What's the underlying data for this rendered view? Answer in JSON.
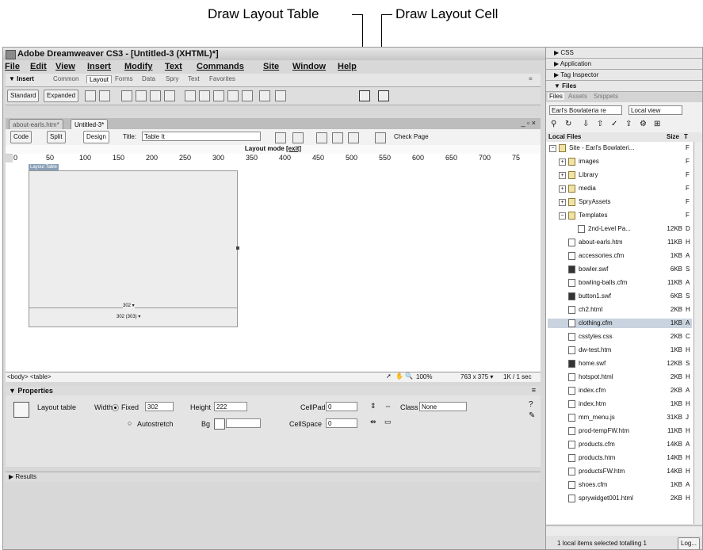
{
  "callouts": {
    "draw_layout_table": "Draw Layout Table",
    "draw_layout_cell": "Draw Layout Cell"
  },
  "window": {
    "title": "Adobe Dreamweaver CS3 - [Untitled-3 (XHTML)*]",
    "controls": [
      "_",
      "□",
      "×"
    ]
  },
  "menu": [
    "File",
    "Edit",
    "View",
    "Insert",
    "Modify",
    "Text",
    "Commands",
    "Site",
    "Window",
    "Help"
  ],
  "insert_bar": {
    "label": "▼ Insert",
    "tabs": [
      "Common",
      "Layout",
      "Forms",
      "Data",
      "Spry",
      "Text",
      "Favorites"
    ],
    "active_tab": "Layout",
    "buttons": [
      "Standard",
      "Expanded"
    ]
  },
  "documents": {
    "tabs": [
      "about-earls.htm*",
      "Untitled-3*"
    ],
    "active": "Untitled-3*",
    "view_buttons": [
      "Code",
      "Split",
      "Design"
    ],
    "title_label": "Title:",
    "title_value": "Table It",
    "check_page": "Check Page",
    "layout_mode": "Layout mode",
    "exit": "[exit]"
  },
  "ruler": {
    "ticks": [
      "0",
      "50",
      "100",
      "150",
      "200",
      "250",
      "300",
      "350",
      "400",
      "450",
      "500",
      "550",
      "600",
      "650",
      "700",
      "75"
    ]
  },
  "layout_table": {
    "label": "Layout Table",
    "width_label_1": "302 ▾",
    "width_label_2": "302 (303) ▾"
  },
  "status": {
    "tags": "<body> <table>",
    "zoom": "100%",
    "size": "763 x 375 ▾",
    "download": "1K / 1 sec"
  },
  "properties": {
    "header": "▼ Properties",
    "type": "Layout table",
    "width_label": "Width",
    "fixed_label": "Fixed",
    "width_value": "302",
    "autostretch_label": "Autostretch",
    "height_label": "Height",
    "height_value": "222",
    "bg_label": "Bg",
    "cellpad_label": "CellPad",
    "cellpad_value": "0",
    "cellspace_label": "CellSpace",
    "cellspace_value": "0",
    "class_label": "Class",
    "class_value": "None"
  },
  "results": {
    "label": "▶ Results"
  },
  "panels": {
    "groups": [
      "▶ CSS",
      "▶ Application",
      "▶ Tag Inspector",
      "▼ Files"
    ],
    "files_tabs": [
      "Files",
      "Assets",
      "Snippets"
    ],
    "site_select": "Earl's Bowlateria re",
    "view_select": "Local view",
    "col_local": "Local Files",
    "col_size": "Size",
    "col_type": "T",
    "tree": [
      {
        "name": "Site - Earl's Bowlateri...",
        "size": "",
        "type": "F",
        "level": 0,
        "kind": "site",
        "exp": "−"
      },
      {
        "name": "images",
        "size": "",
        "type": "F",
        "level": 1,
        "kind": "folder",
        "exp": "+"
      },
      {
        "name": "Library",
        "size": "",
        "type": "F",
        "level": 1,
        "kind": "folder",
        "exp": "+"
      },
      {
        "name": "media",
        "size": "",
        "type": "F",
        "level": 1,
        "kind": "folder",
        "exp": "+"
      },
      {
        "name": "SpryAssets",
        "size": "",
        "type": "F",
        "level": 1,
        "kind": "folder",
        "exp": "+"
      },
      {
        "name": "Templates",
        "size": "",
        "type": "F",
        "level": 1,
        "kind": "folder",
        "exp": "−"
      },
      {
        "name": "2nd-Level Pa...",
        "size": "12KB",
        "type": "D",
        "level": 2,
        "kind": "file",
        "exp": ""
      },
      {
        "name": "about-earls.htm",
        "size": "11KB",
        "type": "H",
        "level": 1,
        "kind": "file",
        "exp": ""
      },
      {
        "name": "accessories.cfm",
        "size": "1KB",
        "type": "A",
        "level": 1,
        "kind": "file",
        "exp": ""
      },
      {
        "name": "bowler.swf",
        "size": "6KB",
        "type": "S",
        "level": 1,
        "kind": "swf",
        "exp": ""
      },
      {
        "name": "bowling-balls.cfm",
        "size": "11KB",
        "type": "A",
        "level": 1,
        "kind": "file",
        "exp": ""
      },
      {
        "name": "button1.swf",
        "size": "6KB",
        "type": "S",
        "level": 1,
        "kind": "swf",
        "exp": ""
      },
      {
        "name": "ch2.html",
        "size": "2KB",
        "type": "H",
        "level": 1,
        "kind": "file",
        "exp": ""
      },
      {
        "name": "clothing.cfm",
        "size": "1KB",
        "type": "A",
        "level": 1,
        "kind": "file",
        "exp": "",
        "selected": true
      },
      {
        "name": "csstyles.css",
        "size": "2KB",
        "type": "C",
        "level": 1,
        "kind": "file",
        "exp": ""
      },
      {
        "name": "dw-test.htm",
        "size": "1KB",
        "type": "H",
        "level": 1,
        "kind": "file",
        "exp": ""
      },
      {
        "name": "home.swf",
        "size": "12KB",
        "type": "S",
        "level": 1,
        "kind": "swf",
        "exp": ""
      },
      {
        "name": "hotspot.html",
        "size": "2KB",
        "type": "H",
        "level": 1,
        "kind": "file",
        "exp": ""
      },
      {
        "name": "index.cfm",
        "size": "2KB",
        "type": "A",
        "level": 1,
        "kind": "file",
        "exp": ""
      },
      {
        "name": "index.htm",
        "size": "1KB",
        "type": "H",
        "level": 1,
        "kind": "file",
        "exp": ""
      },
      {
        "name": "mm_menu.js",
        "size": "31KB",
        "type": "J",
        "level": 1,
        "kind": "file",
        "exp": ""
      },
      {
        "name": "prod-tempFW.htm",
        "size": "11KB",
        "type": "H",
        "level": 1,
        "kind": "file",
        "exp": ""
      },
      {
        "name": "products.cfm",
        "size": "14KB",
        "type": "A",
        "level": 1,
        "kind": "file",
        "exp": ""
      },
      {
        "name": "products.htm",
        "size": "14KB",
        "type": "H",
        "level": 1,
        "kind": "file",
        "exp": ""
      },
      {
        "name": "productsFW.htm",
        "size": "14KB",
        "type": "H",
        "level": 1,
        "kind": "file",
        "exp": ""
      },
      {
        "name": "shoes.cfm",
        "size": "1KB",
        "type": "A",
        "level": 1,
        "kind": "file",
        "exp": ""
      },
      {
        "name": "sprywidget001.html",
        "size": "2KB",
        "type": "H",
        "level": 1,
        "kind": "file",
        "exp": ""
      }
    ],
    "footer_status": "1 local items selected totalling 1",
    "log_button": "Log..."
  }
}
